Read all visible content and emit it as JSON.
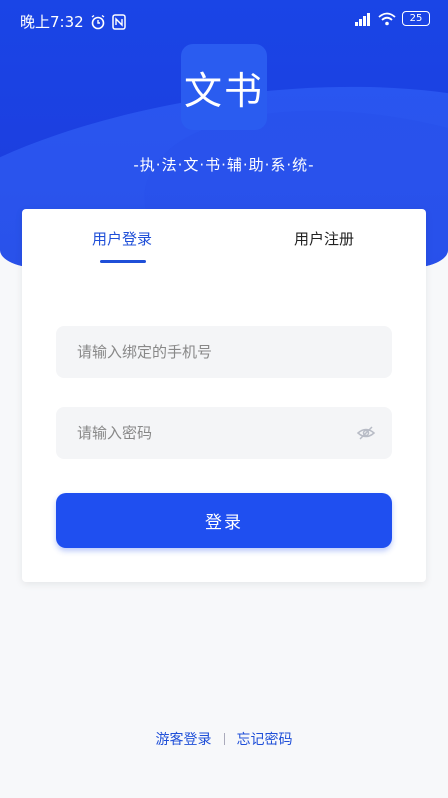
{
  "status_bar": {
    "time": "晚上7:32",
    "battery": "25"
  },
  "brand": {
    "logo_text": "文书",
    "tagline": "-执·法·文·书·辅·助·系·统-"
  },
  "tabs": [
    {
      "label": "用户登录",
      "active": true
    },
    {
      "label": "用户注册",
      "active": false
    }
  ],
  "form": {
    "phone_placeholder": "请输入绑定的手机号",
    "password_placeholder": "请输入密码",
    "login_label": "登录"
  },
  "links": {
    "guest_login": "游客登录",
    "forgot_password": "忘记密码"
  },
  "colors": {
    "accent": "#1f4ff0",
    "header": "#1a45e6"
  }
}
